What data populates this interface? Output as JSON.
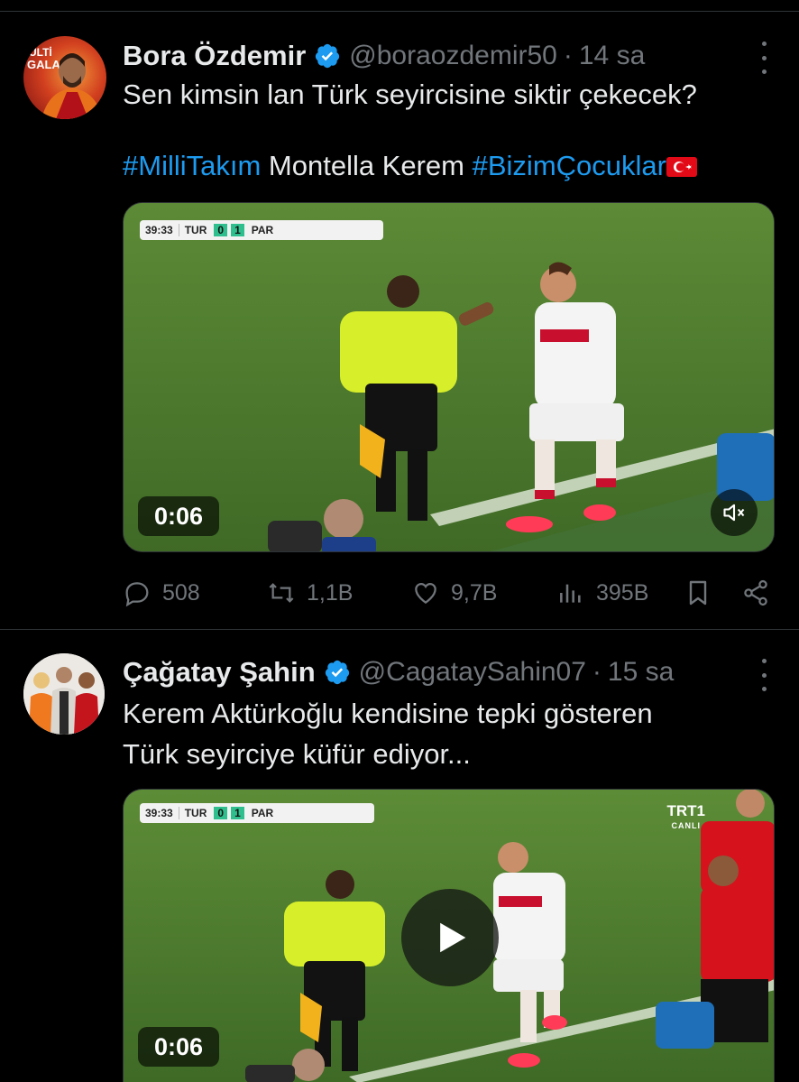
{
  "tweets": [
    {
      "author_name": "Bora Özdemir",
      "handle": "@boraozdemir50",
      "separator": "·",
      "time": "14 sa",
      "text_line1": "Sen kimsin lan Türk seyircisine siktir çekecek?",
      "text_line2_parts": {
        "hashtag1": "#MilliTakım",
        "plain": " Montella Kerem ",
        "hashtag2": "#BizimÇocuklar"
      },
      "video": {
        "duration": "0:06",
        "scoreboard": {
          "clock": "39:33",
          "home": "TUR",
          "home_score": "0",
          "away_score": "1",
          "away": "PAR"
        }
      },
      "stats": {
        "replies": "508",
        "reposts": "1,1B",
        "likes": "9,7B",
        "views": "395B"
      }
    },
    {
      "author_name": "Çağatay Şahin",
      "handle": "@CagataySahin07",
      "separator": "·",
      "time": "15 sa",
      "text_line1": "Kerem Aktürkoğlu kendisine tepki gösteren",
      "text_line2": "Türk seyirciye küfür ediyor...",
      "video": {
        "duration": "0:06",
        "broadcaster": "TRT1",
        "broadcaster_sub": "CANLI",
        "scoreboard": {
          "clock": "39:33",
          "home": "TUR",
          "home_score": "0",
          "away_score": "1",
          "away": "PAR"
        }
      }
    }
  ],
  "icons": {
    "verified": "verified-badge-icon",
    "more": "more-options-icon",
    "reply": "reply-icon",
    "repost": "repost-icon",
    "like": "like-icon",
    "views": "views-icon",
    "bookmark": "bookmark-icon",
    "share": "share-icon",
    "mute": "muted-speaker-icon",
    "play": "play-icon"
  },
  "colors": {
    "background": "#000000",
    "text": "#e7e9ea",
    "muted": "#71767b",
    "link": "#1d9bf0",
    "verified": "#1d9bf0"
  }
}
